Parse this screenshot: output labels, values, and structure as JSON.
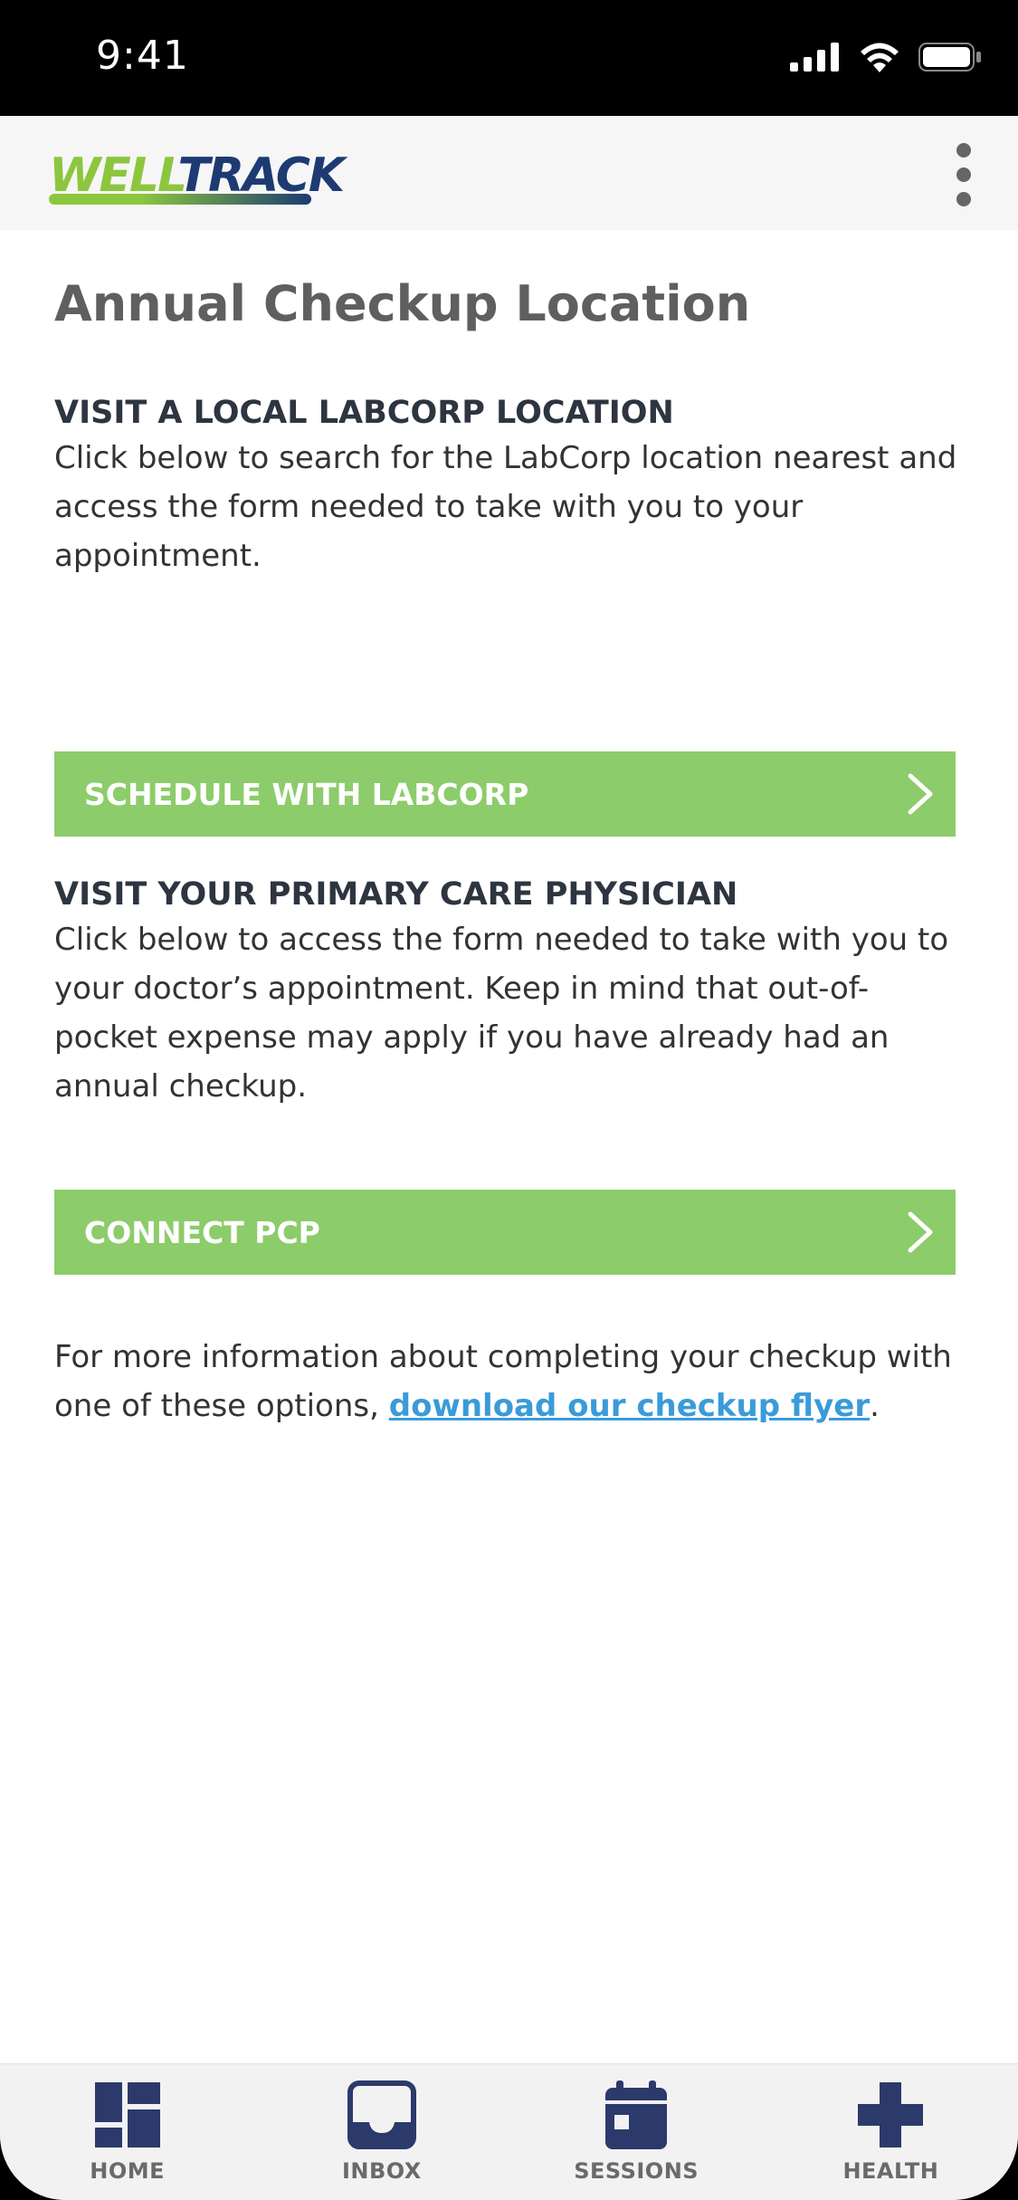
{
  "status_bar": {
    "time": "9:41"
  },
  "header": {
    "logo_part1": "WELL",
    "logo_part2": "TRACK"
  },
  "page": {
    "title": "Annual Checkup Location"
  },
  "sections": [
    {
      "heading": "VISIT A LOCAL LABCORP LOCATION",
      "body": "Click below to search for the LabCorp location nearest and access the form needed to take with you to your appointment.",
      "button_label": "SCHEDULE WITH LABCORP"
    },
    {
      "heading": "VISIT YOUR PRIMARY CARE PHYSICIAN",
      "body": "Click below to access the form needed to take with you to your doctor’s appointment. Keep in mind that out-of-pocket expense may apply if you have already had an annual checkup.",
      "button_label": "CONNECT PCP"
    }
  ],
  "footer": {
    "text_before": "For more information about completing your checkup with one of these options, ",
    "link_text": "download our checkup flyer",
    "text_after": "."
  },
  "tabs": [
    {
      "label": "HOME",
      "icon": "home-grid-icon"
    },
    {
      "label": "INBOX",
      "icon": "inbox-tray-icon"
    },
    {
      "label": "SESSIONS",
      "icon": "calendar-icon"
    },
    {
      "label": "HEALTH",
      "icon": "health-cross-icon"
    }
  ],
  "colors": {
    "accent_green": "#8ccc6a",
    "link_blue": "#3a9bd9",
    "brand_navy": "#2b3a6b",
    "brand_green": "#8cc63f"
  }
}
